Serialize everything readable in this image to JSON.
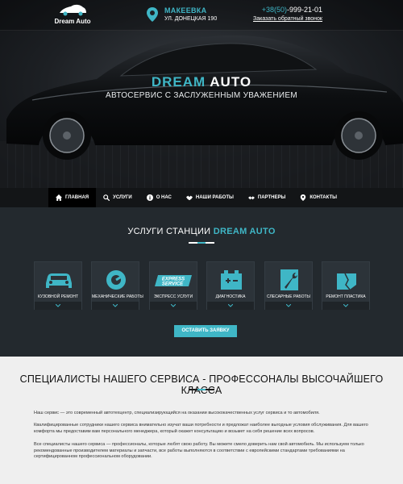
{
  "header": {
    "logo_text": "Dream Auto",
    "city": "МАКЕЕВКА",
    "street": "УЛ. ДОНЕЦКАЯ 190",
    "phone_prefix": "+38(50)",
    "phone_number": "-999-21-01",
    "callback": "Заказать обратный звонок"
  },
  "hero": {
    "title_part1": "DREAM",
    "title_part2": "AUTO",
    "subtitle": "АВТОСЕРВИС С ЗАСЛУЖЕННЫМ УВАЖЕНИЕМ"
  },
  "nav": {
    "items": [
      {
        "label": "Главная",
        "icon": "home-icon"
      },
      {
        "label": "Услуги",
        "icon": "search-icon"
      },
      {
        "label": "О нас",
        "icon": "info-icon"
      },
      {
        "label": "Наши работы",
        "icon": "handshake-icon"
      },
      {
        "label": "Партнеры",
        "icon": "partners-icon"
      },
      {
        "label": "Контакты",
        "icon": "location-icon"
      }
    ]
  },
  "services": {
    "title_part1": "УСЛУГИ СТАНЦИИ",
    "title_part2": "DREAM AUTO",
    "cards": [
      {
        "label": "Кузовной ремонт",
        "icon": "car-body-icon"
      },
      {
        "label": "Механические работы",
        "icon": "gear-icon"
      },
      {
        "label": "Экспресс услуги",
        "icon": "express-service-icon"
      },
      {
        "label": "Диагностика",
        "icon": "battery-icon"
      },
      {
        "label": "Слесарные работы",
        "icon": "wrench-icon"
      },
      {
        "label": "Ремонт пластика",
        "icon": "plastic-panel-icon"
      }
    ],
    "express_icon_line1": "EXPRESS",
    "express_icon_line2": "SERVICE",
    "button": "Оставить заявку"
  },
  "about": {
    "title": "СПЕЦИАЛИСТЫ НАШЕГО СЕРВИСА - ПРОФЕССОНАЛЫ ВЫСОЧАЙШЕГО КЛАССА",
    "p1": "Наш сервис — это современный автотехцентр, специализирующийся на оказании высококачественных услуг сервиса и то автомобиля.",
    "p2": "Квалифицированные сотрудники нашего сервиса внимательно изучат ваши потребности и предложат наиболее выгодные условия обслуживания. Для вашего комфорта мы предоставим вам персонального менеджера, который окажет консультацию и возьмет на себя решение всех вопросов.",
    "p3": "Все специалисты нашего сервиса — профессионалы, которые любят свою работу. Вы можете смело доверить нам свой автомобиль. Мы используем только рекомендованные производителем материалы и запчасти, все работы выполняются в соответствии с европейскими стандартами требованиями на сертифицированном профессиональном оборудовании."
  },
  "colors": {
    "accent": "#3fb6c6",
    "dark": "#23292e",
    "nav": "#131517"
  }
}
